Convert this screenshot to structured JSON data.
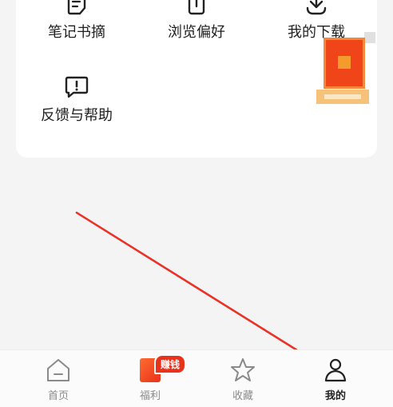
{
  "tools": {
    "notes": {
      "label": "笔记书摘",
      "icon": "note-icon"
    },
    "preferences": {
      "label": "浏览偏好",
      "icon": "phone-icon"
    },
    "downloads": {
      "label": "我的下载",
      "icon": "download-icon"
    },
    "feedback": {
      "label": "反馈与帮助",
      "icon": "feedback-icon"
    }
  },
  "tabbar": {
    "home": {
      "label": "首页",
      "icon": "home-icon"
    },
    "welfare": {
      "label": "福利",
      "icon": "red-envelope-icon",
      "badge": "赚钱"
    },
    "favorites": {
      "label": "收藏",
      "icon": "star-icon"
    },
    "mine": {
      "label": "我的",
      "icon": "person-icon",
      "active": true
    }
  },
  "colors": {
    "accent": "#e8321c",
    "arrow": "#e8231a"
  }
}
